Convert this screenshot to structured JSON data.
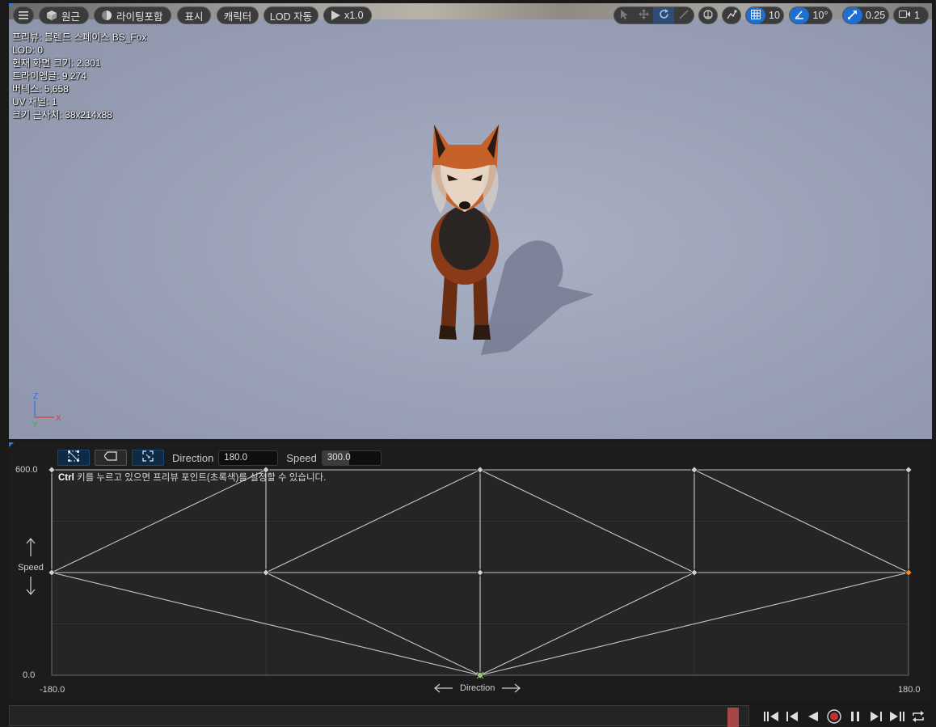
{
  "viewport": {
    "toolbar": {
      "menu_icon": "hamburger-icon",
      "perspective_label": "원근",
      "lighting_label": "라이팅포함",
      "show_label": "표시",
      "character_label": "캐릭터",
      "lod_label": "LOD 자동",
      "play_speed_label": "x1.0",
      "grid_snap_value": "10",
      "rotation_snap_value": "10°",
      "scale_snap_value": "0.25",
      "camera_speed_value": "1"
    },
    "stats": [
      "프리뷰: 블렌드 스페이스 BS_Fox",
      "LOD: 0",
      "현재 화면 크기: 2.301",
      "트라이앵글: 9,274",
      "버텍스: 5,658",
      "UV 채널: 1",
      "크기 근사치: 38x214x88"
    ],
    "axis": {
      "z": "Z",
      "x": "X",
      "y": "Y"
    }
  },
  "blendspace": {
    "direction_label": "Direction",
    "direction_value": "180.0",
    "speed_label": "Speed",
    "speed_value": "300.0",
    "hint_bold": "Ctrl",
    "hint_text": " 키를 누르고 있으면 프리뷰 포인트(초록색)를 설정할 수 있습니다.",
    "y_max_label": "600.0",
    "y_min_label": "0.0",
    "y_axis_name": "Speed",
    "x_min_label": "-180.0",
    "x_max_label": "180.0",
    "x_axis_name": "Direction",
    "colors": {
      "line": "#c8c8c8",
      "preview": "#ff8c1a",
      "sample": "#cfcfcf"
    }
  },
  "chart_data": {
    "type": "scatter",
    "xlabel": "Direction",
    "ylabel": "Speed",
    "xlim": [
      -180,
      180
    ],
    "ylim": [
      0,
      600
    ],
    "samples": [
      {
        "x": -180,
        "y": 600
      },
      {
        "x": -90,
        "y": 600
      },
      {
        "x": 0,
        "y": 600
      },
      {
        "x": 90,
        "y": 600
      },
      {
        "x": 180,
        "y": 600
      },
      {
        "x": -180,
        "y": 300
      },
      {
        "x": -90,
        "y": 300
      },
      {
        "x": 0,
        "y": 300
      },
      {
        "x": 90,
        "y": 300
      },
      {
        "x": 180,
        "y": 300
      },
      {
        "x": 0,
        "y": 0
      }
    ],
    "triangulation_edges": [
      [
        [
          -180,
          300
        ],
        [
          -90,
          600
        ]
      ],
      [
        [
          -90,
          300
        ],
        [
          0,
          600
        ]
      ],
      [
        [
          0,
          600
        ],
        [
          90,
          300
        ]
      ],
      [
        [
          90,
          600
        ],
        [
          180,
          300
        ]
      ],
      [
        [
          -180,
          300
        ],
        [
          0,
          0
        ]
      ],
      [
        [
          -90,
          300
        ],
        [
          0,
          0
        ]
      ],
      [
        [
          90,
          300
        ],
        [
          0,
          0
        ]
      ],
      [
        [
          180,
          300
        ],
        [
          0,
          0
        ]
      ]
    ],
    "preview_point": {
      "x": 180,
      "y": 300
    }
  },
  "timeline": {
    "transport_icons": [
      "skip-to-start-icon",
      "step-back-icon",
      "play-reverse-icon",
      "record-icon",
      "pause-icon",
      "step-forward-icon",
      "skip-to-end-icon",
      "loop-icon"
    ]
  }
}
